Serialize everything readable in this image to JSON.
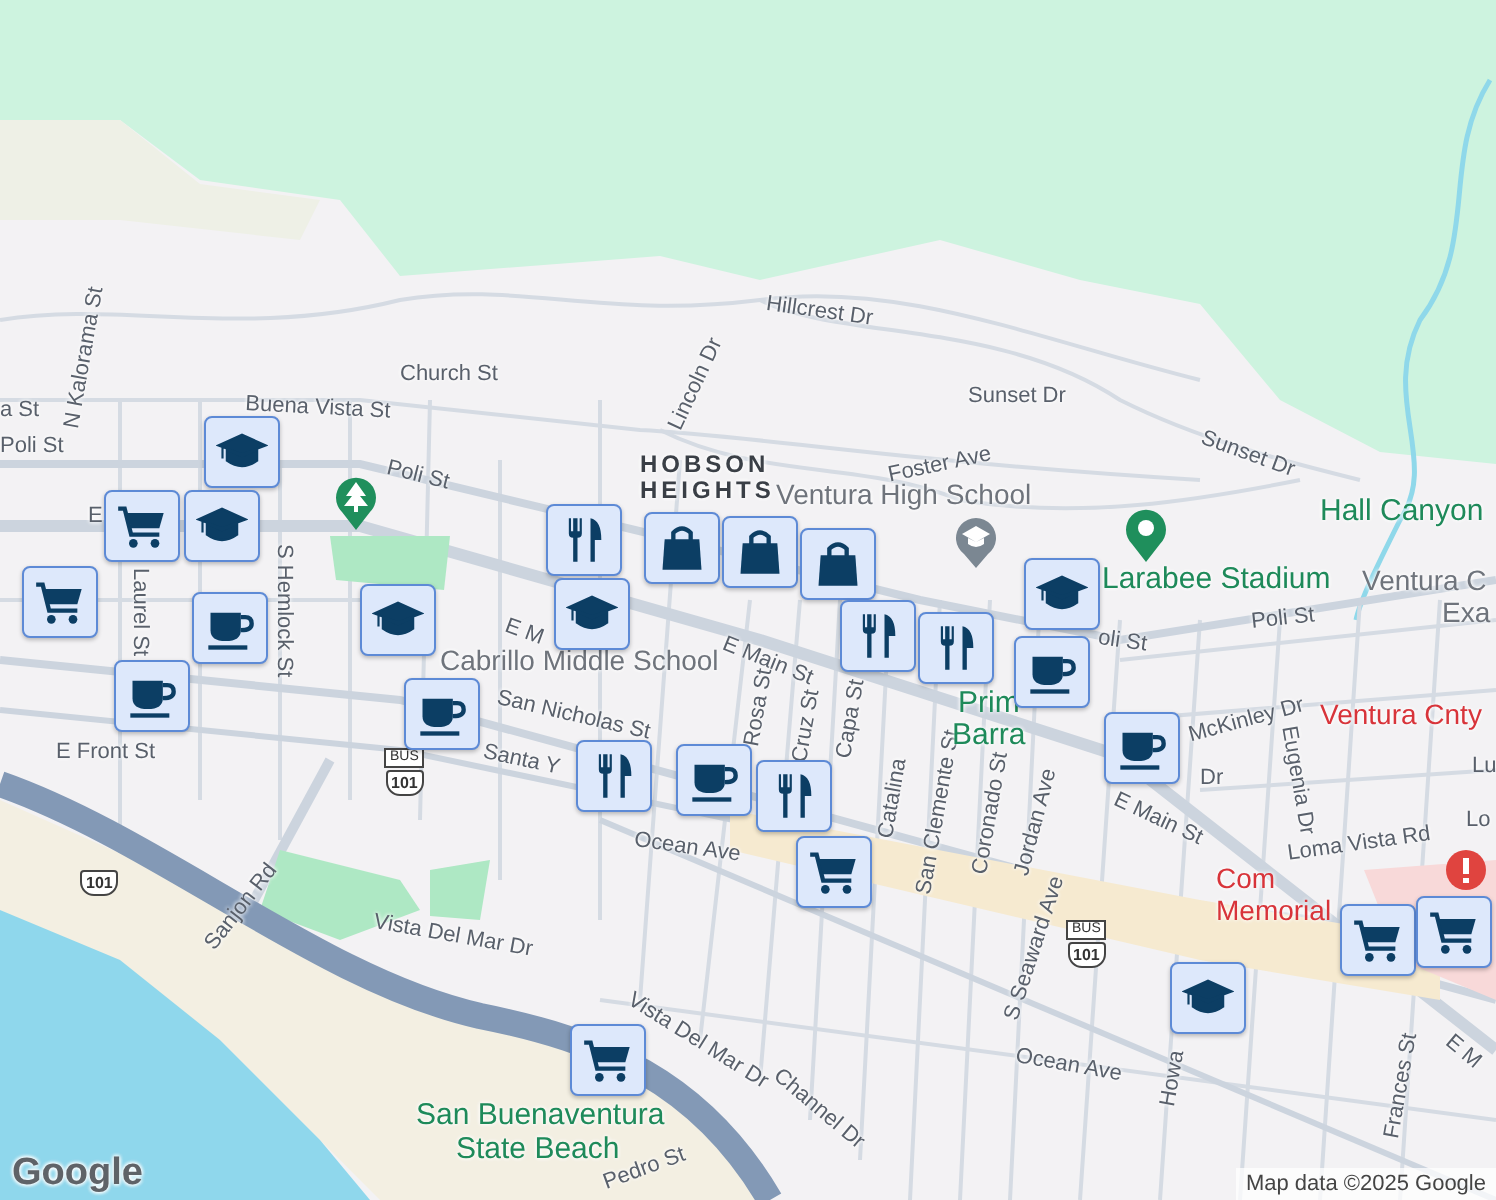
{
  "labels": [
    {
      "text": "Hillcrest Dr",
      "kind": "street"
    },
    {
      "text": "Church St",
      "kind": "street"
    },
    {
      "text": "Sunset Dr",
      "kind": "street"
    },
    {
      "text": "N Kalorama St",
      "kind": "street"
    },
    {
      "text": "a St",
      "kind": "street"
    },
    {
      "text": "Buena Vista St",
      "kind": "street"
    },
    {
      "text": "Lincoln Dr",
      "kind": "street"
    },
    {
      "text": "Foster Ave",
      "kind": "street"
    },
    {
      "text": "Sunset Dr",
      "kind": "street"
    },
    {
      "text": "Poli St",
      "kind": "street"
    },
    {
      "text": "Poli St",
      "kind": "street"
    },
    {
      "text": "HOBSON",
      "kind": "area"
    },
    {
      "text": "HEIGHTS",
      "kind": "area"
    },
    {
      "text": "Ventura High School",
      "kind": "place"
    },
    {
      "text": "Hall Canyon",
      "kind": "park"
    },
    {
      "text": "Larabee Stadium",
      "kind": "park"
    },
    {
      "text": "Ventura C",
      "kind": "place"
    },
    {
      "text": "Exa",
      "kind": "place"
    },
    {
      "text": "oli St",
      "kind": "street"
    },
    {
      "text": "Poli St",
      "kind": "street"
    },
    {
      "text": "E",
      "kind": "street"
    },
    {
      "text": "E M",
      "kind": "street"
    },
    {
      "text": "E Main St",
      "kind": "street"
    },
    {
      "text": "S Hemlock St",
      "kind": "street"
    },
    {
      "text": "Laurel St",
      "kind": "street"
    },
    {
      "text": "Cabrillo Middle School",
      "kind": "place"
    },
    {
      "text": "San Nicholas St",
      "kind": "street"
    },
    {
      "text": "E Front St",
      "kind": "street"
    },
    {
      "text": "Santa Y",
      "kind": "street"
    },
    {
      "text": "Rosa St",
      "kind": "street"
    },
    {
      "text": "Cruz St",
      "kind": "street"
    },
    {
      "text": "Capa St",
      "kind": "street"
    },
    {
      "text": "Catalina",
      "kind": "street"
    },
    {
      "text": "San Clemente St",
      "kind": "street"
    },
    {
      "text": "Coronado St",
      "kind": "street"
    },
    {
      "text": "Jordan Ave",
      "kind": "street"
    },
    {
      "text": "Prim",
      "kind": "park"
    },
    {
      "text": "Barra",
      "kind": "park"
    },
    {
      "text": "McKinley Dr",
      "kind": "street"
    },
    {
      "text": "Ventura Cnty",
      "kind": "hospital"
    },
    {
      "text": "Lu",
      "kind": "street"
    },
    {
      "text": "Dr",
      "kind": "street"
    },
    {
      "text": "E Main St",
      "kind": "street"
    },
    {
      "text": "Eugenia Dr",
      "kind": "street"
    },
    {
      "text": "Loma Vista Rd",
      "kind": "street"
    },
    {
      "text": "Lo",
      "kind": "street"
    },
    {
      "text": "Com",
      "kind": "hospital"
    },
    {
      "text": "Memorial",
      "kind": "hospital"
    },
    {
      "text": "S Seaward Ave",
      "kind": "street"
    },
    {
      "text": "Ocean Ave",
      "kind": "street"
    },
    {
      "text": "Vista Del Mar Dr",
      "kind": "street"
    },
    {
      "text": "Sanjon Rd",
      "kind": "street"
    },
    {
      "text": "Vista Del Mar Dr",
      "kind": "street"
    },
    {
      "text": "Ocean Ave",
      "kind": "street"
    },
    {
      "text": "Howa",
      "kind": "street"
    },
    {
      "text": "Frances St",
      "kind": "street"
    },
    {
      "text": "E M",
      "kind": "street"
    },
    {
      "text": "Channel Dr",
      "kind": "street"
    },
    {
      "text": "Pedro St",
      "kind": "street"
    },
    {
      "text": "San Buenaventura",
      "kind": "park"
    },
    {
      "text": "State Beach",
      "kind": "park"
    }
  ],
  "route_shields": [
    {
      "top": "BUS",
      "number": "101"
    },
    {
      "number": "101"
    },
    {
      "top": "BUS",
      "number": "101"
    }
  ],
  "markers": [
    {
      "kind": "school"
    },
    {
      "kind": "school"
    },
    {
      "kind": "grocery"
    },
    {
      "kind": "grocery"
    },
    {
      "kind": "cafe"
    },
    {
      "kind": "cafe"
    },
    {
      "kind": "school"
    },
    {
      "kind": "restaurant"
    },
    {
      "kind": "school"
    },
    {
      "kind": "cafe"
    },
    {
      "kind": "shopping"
    },
    {
      "kind": "shopping"
    },
    {
      "kind": "shopping"
    },
    {
      "kind": "restaurant"
    },
    {
      "kind": "restaurant"
    },
    {
      "kind": "school"
    },
    {
      "kind": "cafe"
    },
    {
      "kind": "cafe"
    },
    {
      "kind": "restaurant"
    },
    {
      "kind": "cafe"
    },
    {
      "kind": "restaurant"
    },
    {
      "kind": "grocery"
    },
    {
      "kind": "grocery"
    },
    {
      "kind": "grocery"
    },
    {
      "kind": "school"
    },
    {
      "kind": "grocery"
    }
  ],
  "logo": "Google",
  "attribution": "Map data ©2025 Google"
}
